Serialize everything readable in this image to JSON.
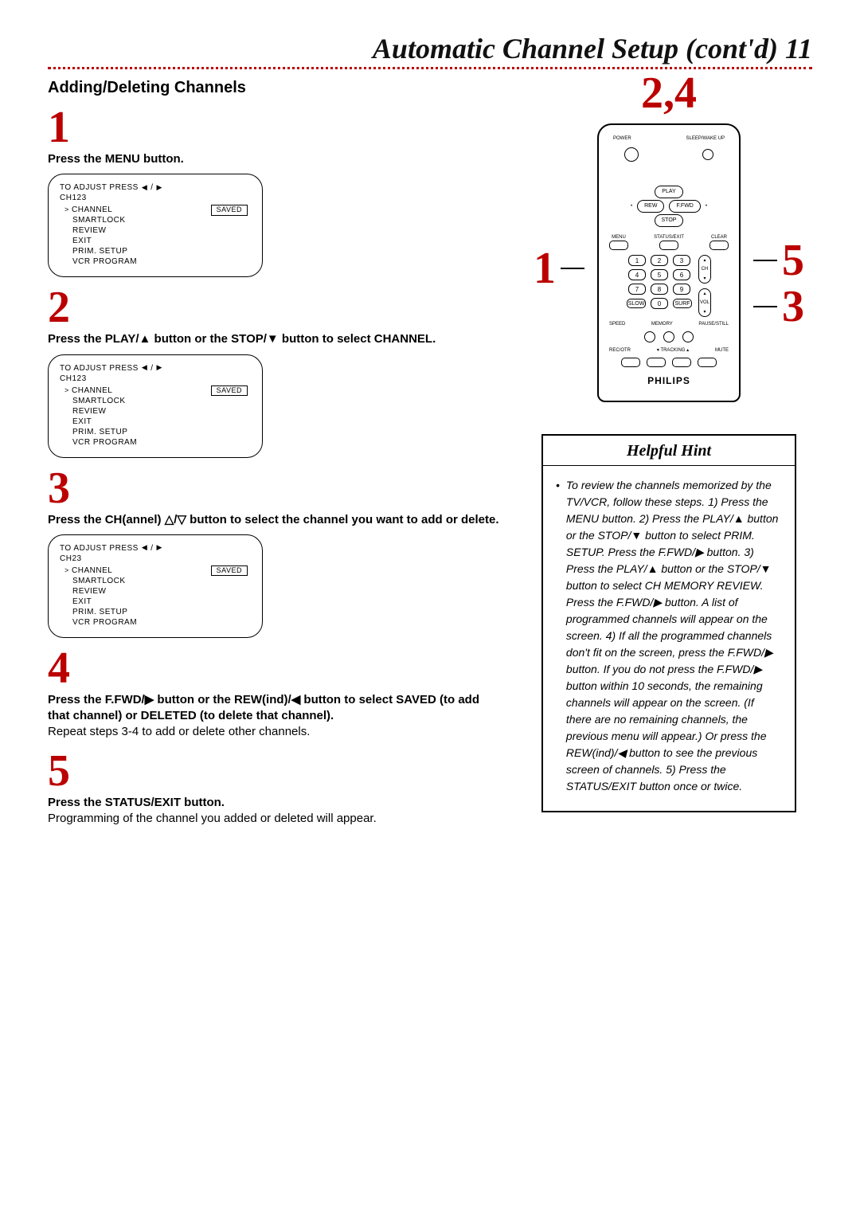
{
  "page": {
    "title": "Automatic Channel Setup (cont'd)  11",
    "section": "Adding/Deleting Channels"
  },
  "steps": {
    "s1": {
      "num": "1",
      "text": "Press the MENU button."
    },
    "s2": {
      "num": "2",
      "text_a": "Press the PLAY/",
      "text_b": " button or the STOP/",
      "text_c": " button to select CHANNEL."
    },
    "s3": {
      "num": "3",
      "text_a": "Press the CH(annel) ",
      "text_b": " button to select the channel you want to add or delete."
    },
    "s4": {
      "num": "4",
      "text_a": "Press the F.FWD/",
      "text_b": " button or the REW(ind)/",
      "text_c": " button to select SAVED (to add that channel) or DELETED (to delete that channel).",
      "repeat": "Repeat steps 3-4 to add or delete other channels."
    },
    "s5": {
      "num": "5",
      "text": "Press the STATUS/EXIT button.",
      "sub": "Programming of the channel you added or deleted will appear."
    }
  },
  "osd": {
    "header": "TO ADJUST PRESS",
    "ch_a": "CH123",
    "ch_b": "CH123",
    "ch_c": "CH23",
    "cursor": ">",
    "items": [
      "CHANNEL",
      "SMARTLOCK",
      "REVIEW",
      "EXIT",
      "PRIM. SETUP",
      "VCR PROGRAM"
    ],
    "saved": "SAVED"
  },
  "callouts": {
    "top": "2,4",
    "c1": "1",
    "c5": "5",
    "c3": "3"
  },
  "remote": {
    "lbl_power": "POWER",
    "lbl_sleep": "SLEEP/WAKE UP",
    "play": "PLAY",
    "rew": "REW",
    "ffwd": "F.FWD",
    "stop": "STOP",
    "menu": "MENU",
    "status": "STATUS/EXIT",
    "clear": "CLEAR",
    "k1": "1",
    "k2": "2",
    "k3": "3",
    "k4": "4",
    "k5": "5",
    "k6": "6",
    "k7": "7",
    "k8": "8",
    "k9": "9",
    "k0": "0",
    "slow": "SLOW",
    "surf": "SURF",
    "ch": "CH",
    "vol": "VOL",
    "speed": "SPEED",
    "memory": "MEMORY",
    "pause": "PAUSE/STILL",
    "rec": "REC/OTR",
    "track": "TRACKING",
    "mute": "MUTE",
    "brand": "PHILIPS"
  },
  "hint": {
    "title": "Helpful Hint",
    "bullet": "•",
    "text": "To review the channels memorized by the TV/VCR, follow these steps. 1) Press the MENU button. 2) Press the PLAY/▲ button or the STOP/▼ button to select PRIM. SETUP. Press the F.FWD/▶ button. 3) Press the PLAY/▲ button or the STOP/▼ button to select CH MEMORY REVIEW. Press the F.FWD/▶ button. A list of programmed channels will appear on the screen. 4) If all the programmed channels don't fit on the screen, press the F.FWD/▶ button. If you do not press the F.FWD/▶ button within 10 seconds, the remaining channels will appear on the screen. (If there are no remaining channels, the previous menu will appear.) Or press the REW(ind)/◀ button to see the previous screen of channels. 5) Press the STATUS/EXIT button once or twice."
  }
}
